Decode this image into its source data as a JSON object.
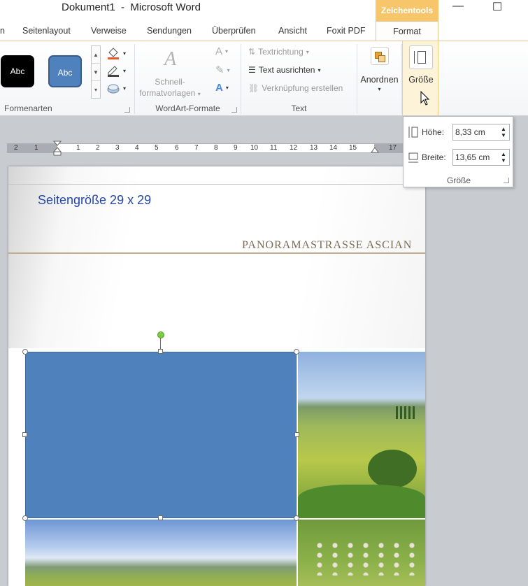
{
  "window": {
    "title": "Dokument1  -  Microsoft Word",
    "contextual_tab_group": "Zeichentools",
    "minimize_glyph": "—",
    "maximize_glyph": "☐"
  },
  "tabs": {
    "partial": "n",
    "items": [
      "Seitenlayout",
      "Verweise",
      "Sendungen",
      "Überprüfen",
      "Ansicht",
      "Foxit PDF"
    ],
    "active": "Format"
  },
  "ribbon": {
    "formenarten": {
      "label": "Formenarten",
      "style1": "Abc",
      "style2": "Abc"
    },
    "wordart": {
      "label": "WordArt-Formate",
      "quick_styles_line1": "Schnell-",
      "quick_styles_line2": "formatvorlagen"
    },
    "text": {
      "label": "Text",
      "direction": "Textrichtung",
      "align": "Text ausrichten",
      "link": "Verknüpfung erstellen"
    },
    "arrange": {
      "label": "Anordnen"
    },
    "size": {
      "label": "Größe"
    }
  },
  "ruler": {
    "ticks": [
      "2",
      "1",
      "1",
      "2",
      "3",
      "4",
      "5",
      "6",
      "7",
      "8",
      "9",
      "10",
      "11",
      "12",
      "13",
      "14",
      "15",
      "17"
    ]
  },
  "page": {
    "label": "Seitengröße 29 x 29",
    "heading": "PANORAMASTRASSE  ASCIAN"
  },
  "size_popup": {
    "height_label": "Höhe:",
    "height_value": "8,33  cm",
    "width_label": "Breite:",
    "width_value": "13,65  cm",
    "group_label": "Größe"
  },
  "colors": {
    "accent": "#f7c66a",
    "shape_fill": "#4f81bd",
    "page_label": "#2447a8"
  }
}
